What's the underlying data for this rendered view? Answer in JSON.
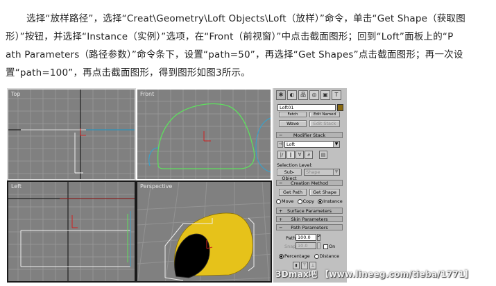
{
  "article": {
    "lines": [
      "选择“放样路径”，选择“Creat\\Geometry\\Loft Objects\\Loft（放样）”命令，单击“Get Shape（获取图",
      "形）”按钮，并选择“Instance（实例）”选项，在“Front（前视窗）”中点击截面图形；回到“Loft”面板上的“P",
      "ath Parameters（路径参数）”命令条下，设置“path=50”，再选择“Get Shapes”点击截面图形；再一次设",
      "置“path=100”，再点击截面图形，得到图形如图3所示。"
    ]
  },
  "viewports": {
    "top": "Top",
    "front": "Front",
    "left": "Left",
    "perspective": "Perspective"
  },
  "panel": {
    "object_name": "Loft01",
    "btn_fetch": "Fetch",
    "btn_edit_named": "Edit Named",
    "btn_wave": "Wave",
    "btn_edit_stack": "Edit Stack",
    "modifier_stack": "Modifier Stack",
    "modifier_value": "Loft",
    "selection_level": "Selection Level:",
    "sub_object": "Sub-Object",
    "sub_object_value": "Shape",
    "creation_method": "Creation Method",
    "get_path": "Get Path",
    "get_shape": "Get Shape",
    "opt_move": "Move",
    "opt_copy": "Copy",
    "opt_instance": "Instance",
    "surface_parameters": "Surface Parameters",
    "skin_parameters": "Skin Parameters",
    "path_parameters": "Path Parameters",
    "path_label": "Path:",
    "path_value": "100.0",
    "snap_label": "Snap:",
    "snap_value": "10.0",
    "on_label": "On",
    "opt_percentage": "Percentage",
    "opt_distance": "Distance"
  },
  "watermark": "3Dmax吧 【www.lineeg.com/tieba/1771】",
  "colors": {
    "viewport_bg": "#808080",
    "green_shape": "#5ee05e",
    "blue_path": "#3aa0c8",
    "yellow_object": "#e6c21a"
  }
}
